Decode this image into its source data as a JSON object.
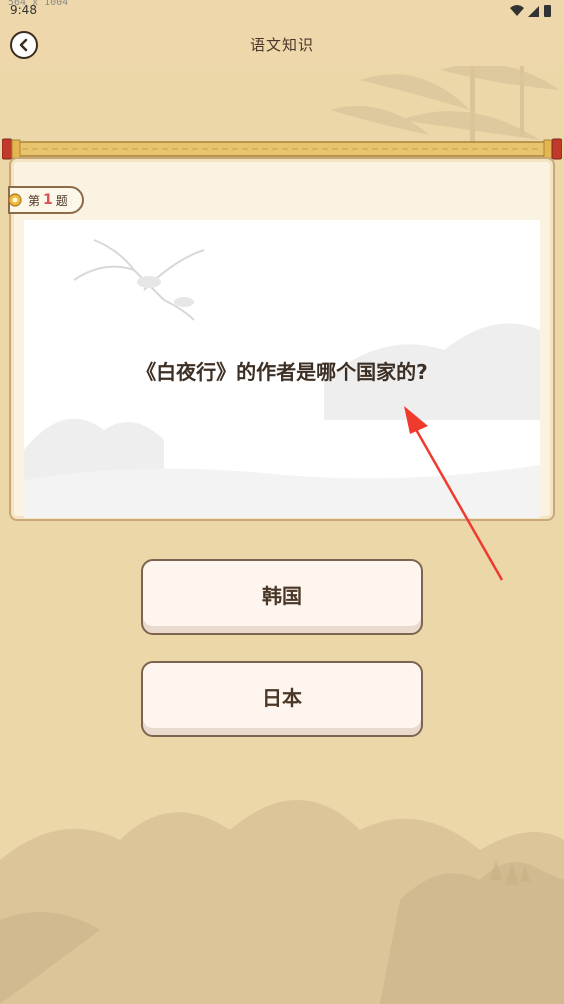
{
  "status_bar": {
    "time": "9:48",
    "dimension_overlay": "564 x 1004"
  },
  "header": {
    "title": "语文知识"
  },
  "question": {
    "prefix": "第",
    "number": "1",
    "suffix": "题",
    "text": "《白夜行》的作者是哪个国家的?"
  },
  "answers": [
    {
      "label": "韩国"
    },
    {
      "label": "日本"
    }
  ],
  "colors": {
    "background": "#ecd7a9",
    "accent_red": "#d9534f",
    "annotation_arrow": "#f03a2e"
  }
}
